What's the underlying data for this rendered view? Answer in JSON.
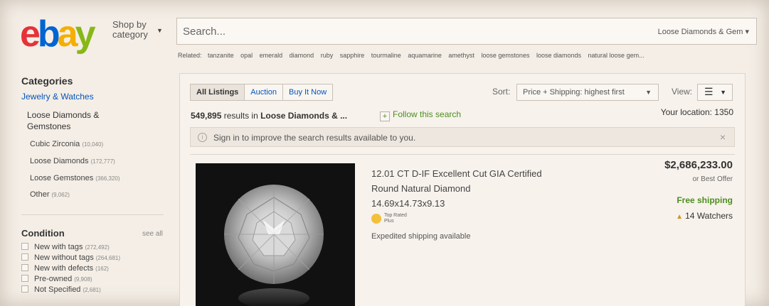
{
  "header": {
    "logo": {
      "e": "e",
      "b": "b",
      "a": "a",
      "y": "y"
    },
    "shop_by_line1": "Shop by",
    "shop_by_line2": "category",
    "search_placeholder": "Search...",
    "search_category": "Loose Diamonds & Gem ▾",
    "related_label": "Related:",
    "related": [
      "tanzanite",
      "opal",
      "emerald",
      "diamond",
      "ruby",
      "sapphire",
      "tourmaline",
      "aquamarine",
      "amethyst",
      "loose gemstones",
      "loose diamonds",
      "natural loose gem..."
    ]
  },
  "sidebar": {
    "categories_title": "Categories",
    "parent_link": "Jewelry & Watches",
    "selected": "Loose Diamonds & Gemstones",
    "subcategories": [
      {
        "label": "Cubic Zirconia",
        "count": "(10,040)"
      },
      {
        "label": "Loose Diamonds",
        "count": "(172,777)"
      },
      {
        "label": "Loose Gemstones",
        "count": "(366,320)"
      },
      {
        "label": "Other",
        "count": "(9,062)"
      }
    ],
    "condition_title": "Condition",
    "see_all": "see all",
    "conditions": [
      {
        "label": "New with tags",
        "count": "(272,492)"
      },
      {
        "label": "New without tags",
        "count": "(264,681)"
      },
      {
        "label": "New with defects",
        "count": "(162)"
      },
      {
        "label": "Pre-owned",
        "count": "(9,908)"
      },
      {
        "label": "Not Specified",
        "count": "(2,681)"
      }
    ]
  },
  "main": {
    "tabs": [
      "All Listings",
      "Auction",
      "Buy It Now"
    ],
    "sort_label": "Sort:",
    "sort_value": "Price + Shipping: highest first",
    "view_label": "View:",
    "view_icon": "list-view-icon",
    "view_glyph": "☰",
    "results_count": "549,895",
    "results_text": " results in ",
    "results_category": "Loose Diamonds & ...",
    "follow_label": "Follow this search",
    "location": "Your location: 1350",
    "signin_text": "Sign in to improve the search results available to you.",
    "close_glyph": "×"
  },
  "listing": {
    "title": "12.01 CT D-IF Excellent Cut GIA Certified Round Natural Diamond 14.69x14.73x9.13",
    "top_rated_line1": "Top Rated",
    "top_rated_line2": "Plus",
    "expedited": "Expedited shipping available",
    "price": "$2,686,233.00",
    "best_offer": "or Best Offer",
    "shipping": "Free shipping",
    "watchers": "14 Watchers"
  },
  "colors": {
    "logo_e": "#e53238",
    "logo_b": "#0064d2",
    "logo_a": "#f5af02",
    "logo_y": "#86b817",
    "link": "#0654ba",
    "green": "#4b8f1f"
  }
}
